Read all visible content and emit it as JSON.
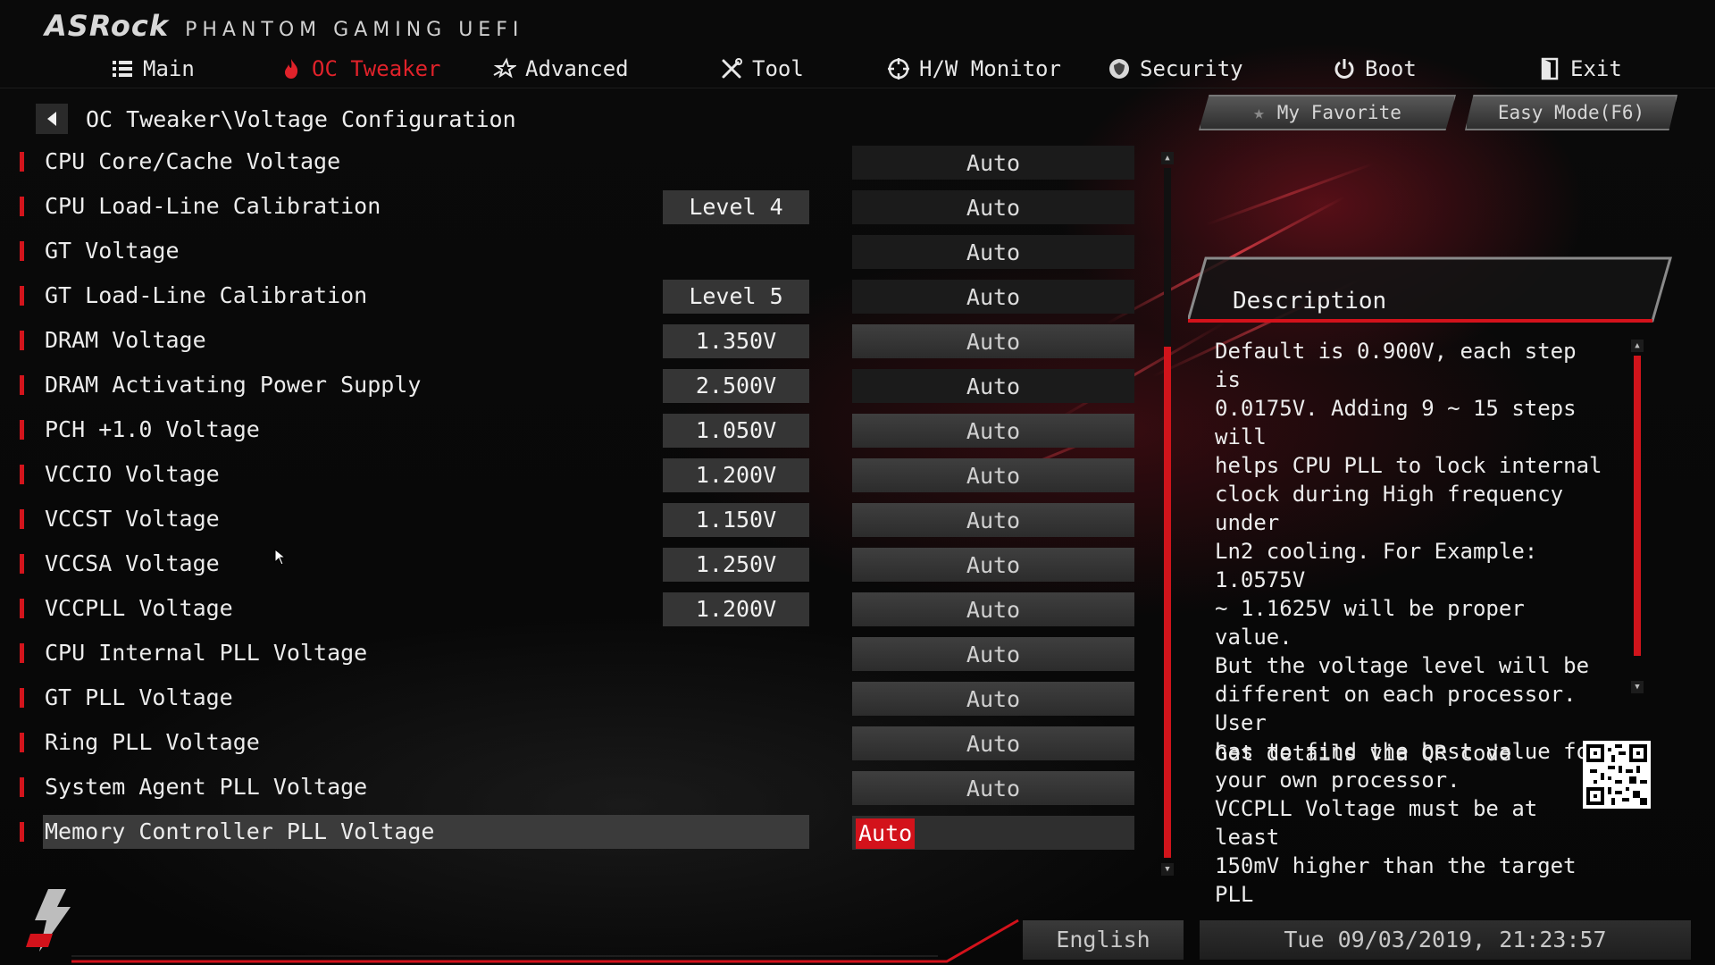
{
  "header": {
    "brand": "ASRock",
    "subtitle": "PHANTOM GAMING UEFI"
  },
  "nav": [
    {
      "label": "Main",
      "icon": "list-icon",
      "active": false
    },
    {
      "label": "OC Tweaker",
      "icon": "flame-icon",
      "active": true
    },
    {
      "label": "Advanced",
      "icon": "star-icon",
      "active": false
    },
    {
      "label": "Tool",
      "icon": "tools-icon",
      "active": false
    },
    {
      "label": "H/W Monitor",
      "icon": "crosshair-icon",
      "active": false
    },
    {
      "label": "Security",
      "icon": "shield-icon",
      "active": false
    },
    {
      "label": "Boot",
      "icon": "power-icon",
      "active": false
    },
    {
      "label": "Exit",
      "icon": "exit-icon",
      "active": false
    }
  ],
  "breadcrumb": "OC Tweaker\\Voltage Configuration",
  "buttons": {
    "favorite": "My Favorite",
    "easy_mode": "Easy Mode(F6)"
  },
  "settings": [
    {
      "label": "CPU Core/Cache Voltage",
      "current": "",
      "value": "Auto"
    },
    {
      "label": "CPU Load-Line Calibration",
      "current": "Level 4",
      "value": "Auto"
    },
    {
      "label": "GT Voltage",
      "current": "",
      "value": "Auto"
    },
    {
      "label": "GT Load-Line Calibration",
      "current": "Level 5",
      "value": "Auto"
    },
    {
      "label": "DRAM Voltage",
      "current": "1.350V",
      "value": "Auto"
    },
    {
      "label": "DRAM Activating Power Supply",
      "current": "2.500V",
      "value": "Auto"
    },
    {
      "label": "PCH +1.0 Voltage",
      "current": "1.050V",
      "value": "Auto"
    },
    {
      "label": "VCCIO Voltage",
      "current": "1.200V",
      "value": "Auto"
    },
    {
      "label": "VCCST Voltage",
      "current": "1.150V",
      "value": "Auto"
    },
    {
      "label": "VCCSA Voltage",
      "current": "1.250V",
      "value": "Auto"
    },
    {
      "label": "VCCPLL Voltage",
      "current": "1.200V",
      "value": "Auto"
    },
    {
      "label": "CPU Internal PLL Voltage",
      "current": "",
      "value": "Auto"
    },
    {
      "label": "GT PLL Voltage",
      "current": "",
      "value": "Auto"
    },
    {
      "label": "Ring PLL Voltage",
      "current": "",
      "value": "Auto"
    },
    {
      "label": "System Agent PLL Voltage",
      "current": "",
      "value": "Auto"
    },
    {
      "label": "Memory Controller PLL Voltage",
      "current": "",
      "value": "Auto",
      "selected": true
    }
  ],
  "description": {
    "title": "Description",
    "text": "Default is 0.900V, each step is\n0.0175V. Adding 9 ~ 15 steps will\nhelps CPU PLL to lock internal\nclock during High frequency under\nLn2 cooling. For Example: 1.0575V\n~ 1.1625V will be proper value.\nBut the voltage level will be\ndifferent on each processor. User\nhas to find the best value for\nyour own processor.\nVCCPLL Voltage must be at least\n150mV higher than the target PLL",
    "qr_label": "Get details via QR code"
  },
  "footer": {
    "language": "English",
    "datetime": "Tue 09/03/2019, 21:23:57"
  },
  "colors": {
    "accent": "#d3121b",
    "background": "#050505"
  }
}
